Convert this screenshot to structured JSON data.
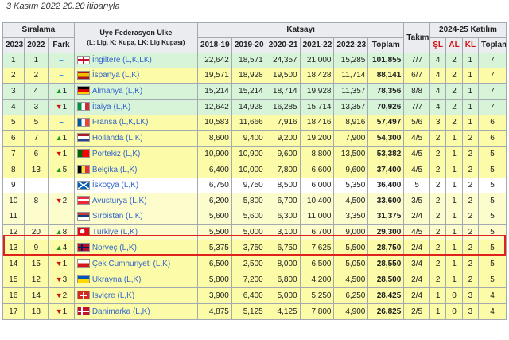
{
  "caption": "3 Kasım 2022 20.20 itibarıyla",
  "headers": {
    "ranking": "Sıralama",
    "federation": "Üye Federasyon Ülke",
    "federation_sub": "(L: Lig, K: Kupa, LK: Lig Kupası)",
    "coefficient": "Katsayı",
    "team": "Takım",
    "participation": "2024-25 Katılım",
    "y2023": "2023",
    "y2022": "2022",
    "diff": "Fark",
    "s1819": "2018-19",
    "s1920": "2019-20",
    "s2021": "2020-21",
    "s2122": "2021-22",
    "s2223": "2022-23",
    "total": "Toplam",
    "sl": "ŞL",
    "al": "AL",
    "kl": "KL",
    "ptotal": "Toplam"
  },
  "colors": {
    "highlight": "#e0201a",
    "up": "#1a9a1a",
    "down": "#d01010",
    "same": "#3a9ad9"
  },
  "rows": [
    {
      "r23": "1",
      "r22": "1",
      "dir": "same",
      "d": "",
      "flag": "eng",
      "name": "İngiltere (L,K,LK)",
      "v": [
        "22,642",
        "18,571",
        "24,357",
        "21,000",
        "15,285"
      ],
      "total": "101,855",
      "team": "7/7",
      "sl": "4",
      "al": "2",
      "kl": "1",
      "pt": "7",
      "cls": "green"
    },
    {
      "r23": "2",
      "r22": "2",
      "dir": "same",
      "d": "",
      "flag": "esp",
      "name": "İspanya (L,K)",
      "v": [
        "19,571",
        "18,928",
        "19,500",
        "18,428",
        "11,714"
      ],
      "total": "88,141",
      "team": "6/7",
      "sl": "4",
      "al": "2",
      "kl": "1",
      "pt": "7",
      "cls": "yellow"
    },
    {
      "r23": "3",
      "r22": "4",
      "dir": "up",
      "d": "1",
      "flag": "ger",
      "name": "Almanya (L,K)",
      "v": [
        "15,214",
        "15,214",
        "18,714",
        "19,928",
        "11,357"
      ],
      "total": "78,356",
      "team": "8/8",
      "sl": "4",
      "al": "2",
      "kl": "1",
      "pt": "7",
      "cls": "green"
    },
    {
      "r23": "4",
      "r22": "3",
      "dir": "down",
      "d": "1",
      "flag": "ita",
      "name": "İtalya (L,K)",
      "v": [
        "12,642",
        "14,928",
        "16,285",
        "15,714",
        "13,357"
      ],
      "total": "70,926",
      "team": "7/7",
      "sl": "4",
      "al": "2",
      "kl": "1",
      "pt": "7",
      "cls": "green"
    },
    {
      "r23": "5",
      "r22": "5",
      "dir": "same",
      "d": "",
      "flag": "fra",
      "name": "Fransa (L,K,LK)",
      "v": [
        "10,583",
        "11,666",
        "7,916",
        "18,416",
        "8,916"
      ],
      "total": "57,497",
      "team": "5/6",
      "sl": "3",
      "al": "2",
      "kl": "1",
      "pt": "6",
      "cls": "yellow"
    },
    {
      "r23": "6",
      "r22": "7",
      "dir": "up",
      "d": "1",
      "flag": "ned",
      "name": "Hollanda (L,K)",
      "v": [
        "8,600",
        "9,400",
        "9,200",
        "19,200",
        "7,900"
      ],
      "total": "54,300",
      "team": "4/5",
      "sl": "2",
      "al": "1",
      "kl": "2",
      "pt": "6",
      "cls": "yellow"
    },
    {
      "r23": "7",
      "r22": "6",
      "dir": "down",
      "d": "1",
      "flag": "por",
      "name": "Portekiz (L,K)",
      "v": [
        "10,900",
        "10,900",
        "9,600",
        "8,800",
        "13,500"
      ],
      "total": "53,382",
      "team": "4/5",
      "sl": "2",
      "al": "1",
      "kl": "2",
      "pt": "5",
      "cls": "yellow"
    },
    {
      "r23": "8",
      "r22": "13",
      "dir": "up",
      "d": "5",
      "flag": "bel",
      "name": "Belçika (L,K)",
      "v": [
        "6,400",
        "10,000",
        "7,800",
        "6,600",
        "9,600"
      ],
      "total": "37,400",
      "team": "4/5",
      "sl": "2",
      "al": "1",
      "kl": "2",
      "pt": "5",
      "cls": "yellow"
    },
    {
      "r23": "9",
      "r22": "",
      "dir": "none",
      "d": "",
      "flag": "sco",
      "name": "İskoçya (L,K)",
      "v": [
        "6,750",
        "9,750",
        "8,500",
        "6,000",
        "5,350"
      ],
      "total": "36,400",
      "team": "5",
      "sl": "2",
      "al": "1",
      "kl": "2",
      "pt": "5",
      "cls": "white"
    },
    {
      "r23": "10",
      "r22": "8",
      "dir": "down",
      "d": "2",
      "flag": "aut",
      "name": "Avusturya (L,K)",
      "v": [
        "6,200",
        "5,800",
        "6,700",
        "10,400",
        "4,500"
      ],
      "total": "33,600",
      "team": "3/5",
      "sl": "2",
      "al": "1",
      "kl": "2",
      "pt": "5",
      "cls": "lyellow"
    },
    {
      "r23": "11",
      "r22": "",
      "dir": "none",
      "d": "",
      "flag": "srb",
      "name": "Sırbistan (L,K)",
      "v": [
        "5,600",
        "5,600",
        "6,300",
        "11,000",
        "3,350"
      ],
      "total": "31,375",
      "team": "2/4",
      "sl": "2",
      "al": "1",
      "kl": "2",
      "pt": "5",
      "cls": "lyellow"
    },
    {
      "r23": "12",
      "r22": "20",
      "dir": "up",
      "d": "8",
      "flag": "tur",
      "name": "Türkiye (L,K)",
      "v": [
        "5,500",
        "5,000",
        "3,100",
        "6,700",
        "9,000"
      ],
      "total": "29,300",
      "team": "4/5",
      "sl": "2",
      "al": "1",
      "kl": "2",
      "pt": "5",
      "cls": "lyellow"
    },
    {
      "r23": "13",
      "r22": "9",
      "dir": "up",
      "d": "4",
      "flag": "nor",
      "name": "Norveç (L,K)",
      "v": [
        "5,375",
        "3,750",
        "6,750",
        "7,625",
        "5,500"
      ],
      "total": "28,750",
      "team": "2/4",
      "sl": "2",
      "al": "1",
      "kl": "2",
      "pt": "5",
      "cls": "yellow"
    },
    {
      "r23": "14",
      "r22": "15",
      "dir": "down",
      "d": "1",
      "flag": "cze",
      "name": "Çek Cumhuriyeti (L,K)",
      "v": [
        "6,500",
        "2,500",
        "8,000",
        "6,500",
        "5,050"
      ],
      "total": "28,550",
      "team": "3/4",
      "sl": "2",
      "al": "1",
      "kl": "2",
      "pt": "5",
      "cls": "yellow"
    },
    {
      "r23": "15",
      "r22": "12",
      "dir": "down",
      "d": "3",
      "flag": "ukr",
      "name": "Ukrayna (L,K)",
      "v": [
        "5,800",
        "7,200",
        "6,800",
        "4,200",
        "4,500"
      ],
      "total": "28,500",
      "team": "2/4",
      "sl": "2",
      "al": "1",
      "kl": "2",
      "pt": "5",
      "cls": "yellow"
    },
    {
      "r23": "16",
      "r22": "14",
      "dir": "down",
      "d": "2",
      "flag": "sui",
      "name": "İsviçre (L,K)",
      "v": [
        "3,900",
        "6,400",
        "5,000",
        "5,250",
        "6,250"
      ],
      "total": "28,425",
      "team": "2/4",
      "sl": "1",
      "al": "0",
      "kl": "3",
      "pt": "4",
      "cls": "yellow"
    },
    {
      "r23": "17",
      "r22": "18",
      "dir": "down",
      "d": "1",
      "flag": "den",
      "name": "Danimarka (L,K)",
      "v": [
        "4,875",
        "5,125",
        "4,125",
        "7,800",
        "4,900"
      ],
      "total": "26,825",
      "team": "2/5",
      "sl": "1",
      "al": "0",
      "kl": "3",
      "pt": "4",
      "cls": "yellow"
    }
  ]
}
